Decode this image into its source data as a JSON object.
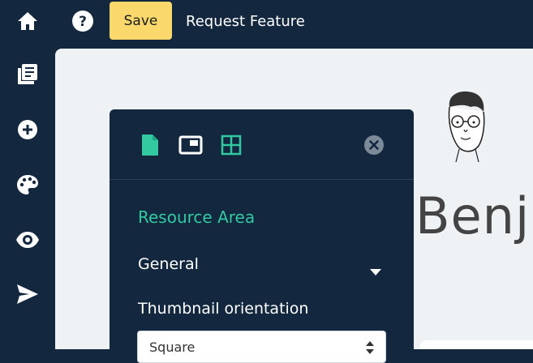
{
  "toolbar": {
    "save_label": "Save",
    "request_feature_label": "Request Feature"
  },
  "sidebar": {
    "items": [
      {
        "name": "home",
        "icon": "home-icon"
      },
      {
        "name": "pages",
        "icon": "pages-icon"
      },
      {
        "name": "add",
        "icon": "plus-circle-icon"
      },
      {
        "name": "theme",
        "icon": "palette-icon"
      },
      {
        "name": "preview",
        "icon": "eye-icon"
      },
      {
        "name": "publish",
        "icon": "send-icon"
      }
    ]
  },
  "canvas": {
    "name_fragment": "Benja"
  },
  "panel": {
    "tabs": [
      {
        "icon": "document-icon",
        "active": true
      },
      {
        "icon": "picture-in-picture-icon",
        "active": false
      },
      {
        "icon": "grid-icon",
        "active": false
      }
    ],
    "section_title": "Resource Area",
    "dropdown_label": "General",
    "thumbnail_label": "Thumbnail orientation",
    "thumbnail_value": "Square"
  },
  "colors": {
    "navy": "#13283f",
    "accent_teal": "#32c8a0",
    "save_yellow": "#fad86c",
    "canvas_bg": "#eff2f4"
  }
}
